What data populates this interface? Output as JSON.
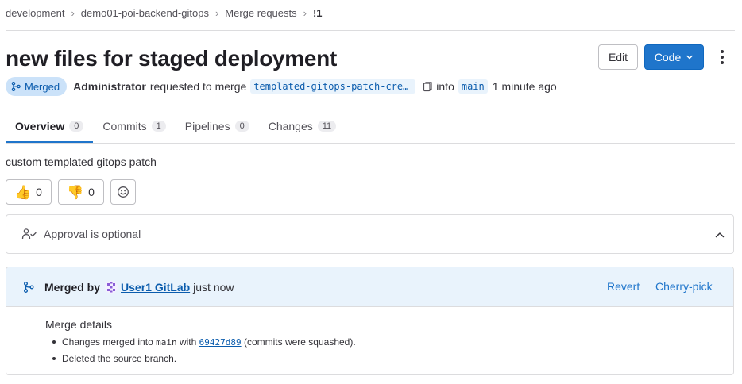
{
  "breadcrumb": {
    "items": [
      "development",
      "demo01-poi-backend-gitops",
      "Merge requests"
    ],
    "current": "!1"
  },
  "title": "new files for staged deployment",
  "actions": {
    "edit_label": "Edit",
    "code_label": "Code"
  },
  "meta": {
    "status": "Merged",
    "author": "Administrator",
    "requested_text": "requested to merge",
    "source_branch": "templated-gitops-patch-create",
    "into_text": "into",
    "target_branch": "main",
    "time": "1 minute ago"
  },
  "tabs": [
    {
      "label": "Overview",
      "count": "0"
    },
    {
      "label": "Commits",
      "count": "1"
    },
    {
      "label": "Pipelines",
      "count": "0"
    },
    {
      "label": "Changes",
      "count": "11"
    }
  ],
  "description": "custom templated gitops patch",
  "awards": {
    "thumbs_up": "0",
    "thumbs_down": "0"
  },
  "approval": {
    "label": "Approval is optional"
  },
  "merged_widget": {
    "merged_by_label": "Merged by",
    "user": "User1 GitLab",
    "when": "just now",
    "revert_label": "Revert",
    "cherry_pick_label": "Cherry-pick",
    "details_title": "Merge details",
    "line1_prefix": "Changes merged into",
    "line1_branch": "main",
    "line1_with": "with",
    "line1_sha": "69427d89",
    "line1_suffix": "(commits were squashed).",
    "line2": "Deleted the source branch."
  },
  "colors": {
    "accent": "#1f75cb",
    "merged_badge_bg": "#cbe2f9",
    "widget_bg": "#e9f3fc"
  }
}
